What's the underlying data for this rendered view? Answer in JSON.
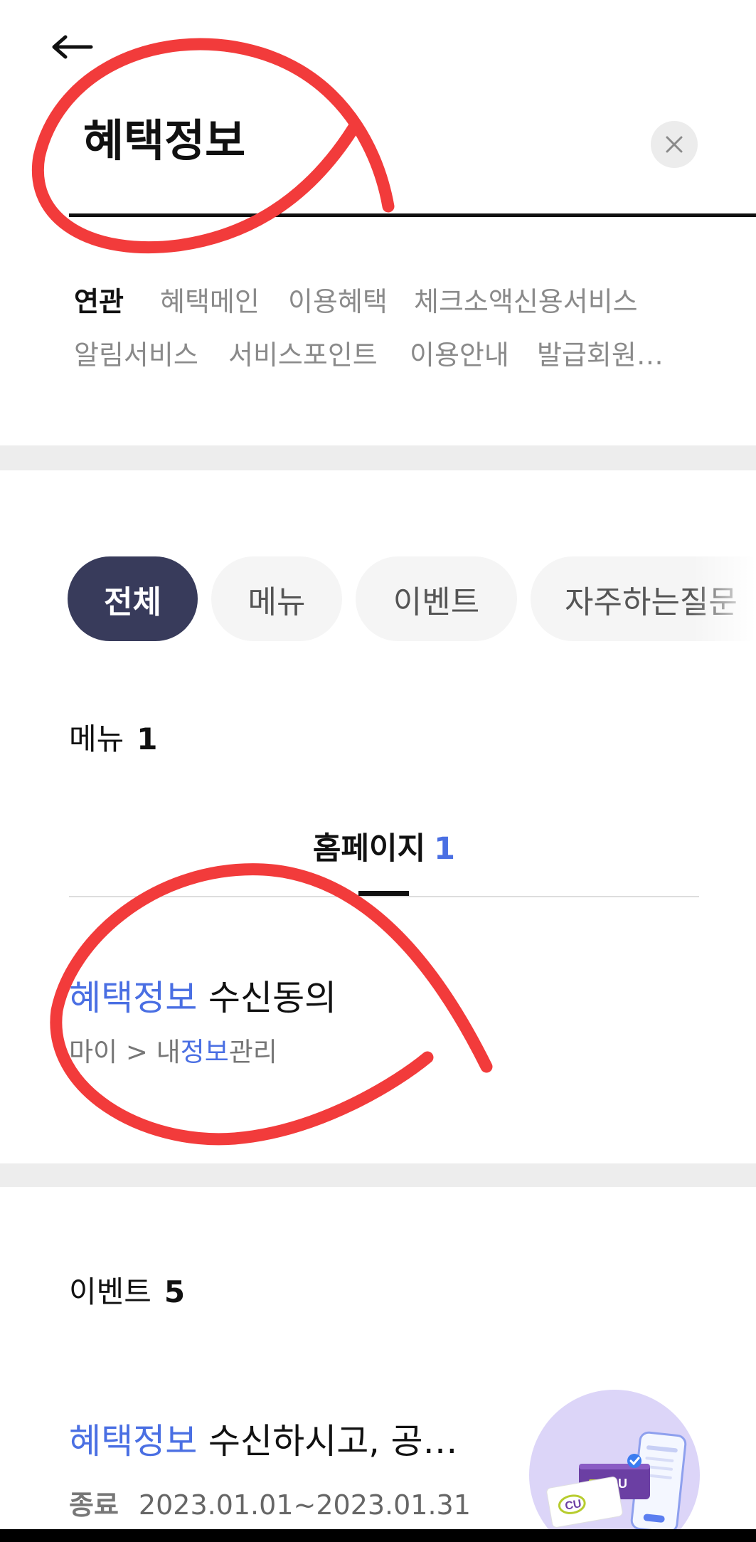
{
  "header": {
    "back_icon": "arrow-left-icon",
    "search_value": "혜택정보",
    "clear_icon": "close-icon"
  },
  "related": {
    "label": "연관",
    "tags": [
      "혜택메인",
      "이용혜택",
      "체크소액신용서비스",
      "알림서비스",
      "서비스포인트",
      "이용안내",
      "발급회원…"
    ]
  },
  "filters": [
    {
      "label": "전체",
      "selected": true
    },
    {
      "label": "메뉴",
      "selected": false
    },
    {
      "label": "이벤트",
      "selected": false
    },
    {
      "label": "자주하는질문",
      "selected": false
    }
  ],
  "menu_section": {
    "title": "메뉴",
    "count": "1",
    "tab": {
      "label": "홈페이지",
      "count": "1"
    },
    "results": [
      {
        "title_highlight": "혜택정보",
        "title_rest": " 수신동의",
        "path_prefix": "마이 > 내",
        "path_highlight": "정보",
        "path_suffix": "관리"
      }
    ]
  },
  "event_section": {
    "title": "이벤트",
    "count": "5",
    "items": [
      {
        "title_highlight": "혜택정보",
        "title_rest": " 수신하시고, 공…",
        "status_label": "종료",
        "period": "2023.01.01~2023.01.31",
        "thumbnail_icon": "event-thumbnail-image",
        "thumbnail_logo_text": "CU"
      }
    ]
  },
  "colors": {
    "accent": "#4a6fe3",
    "chip_active": "#383b5b",
    "annotation": "#f23b3b"
  }
}
